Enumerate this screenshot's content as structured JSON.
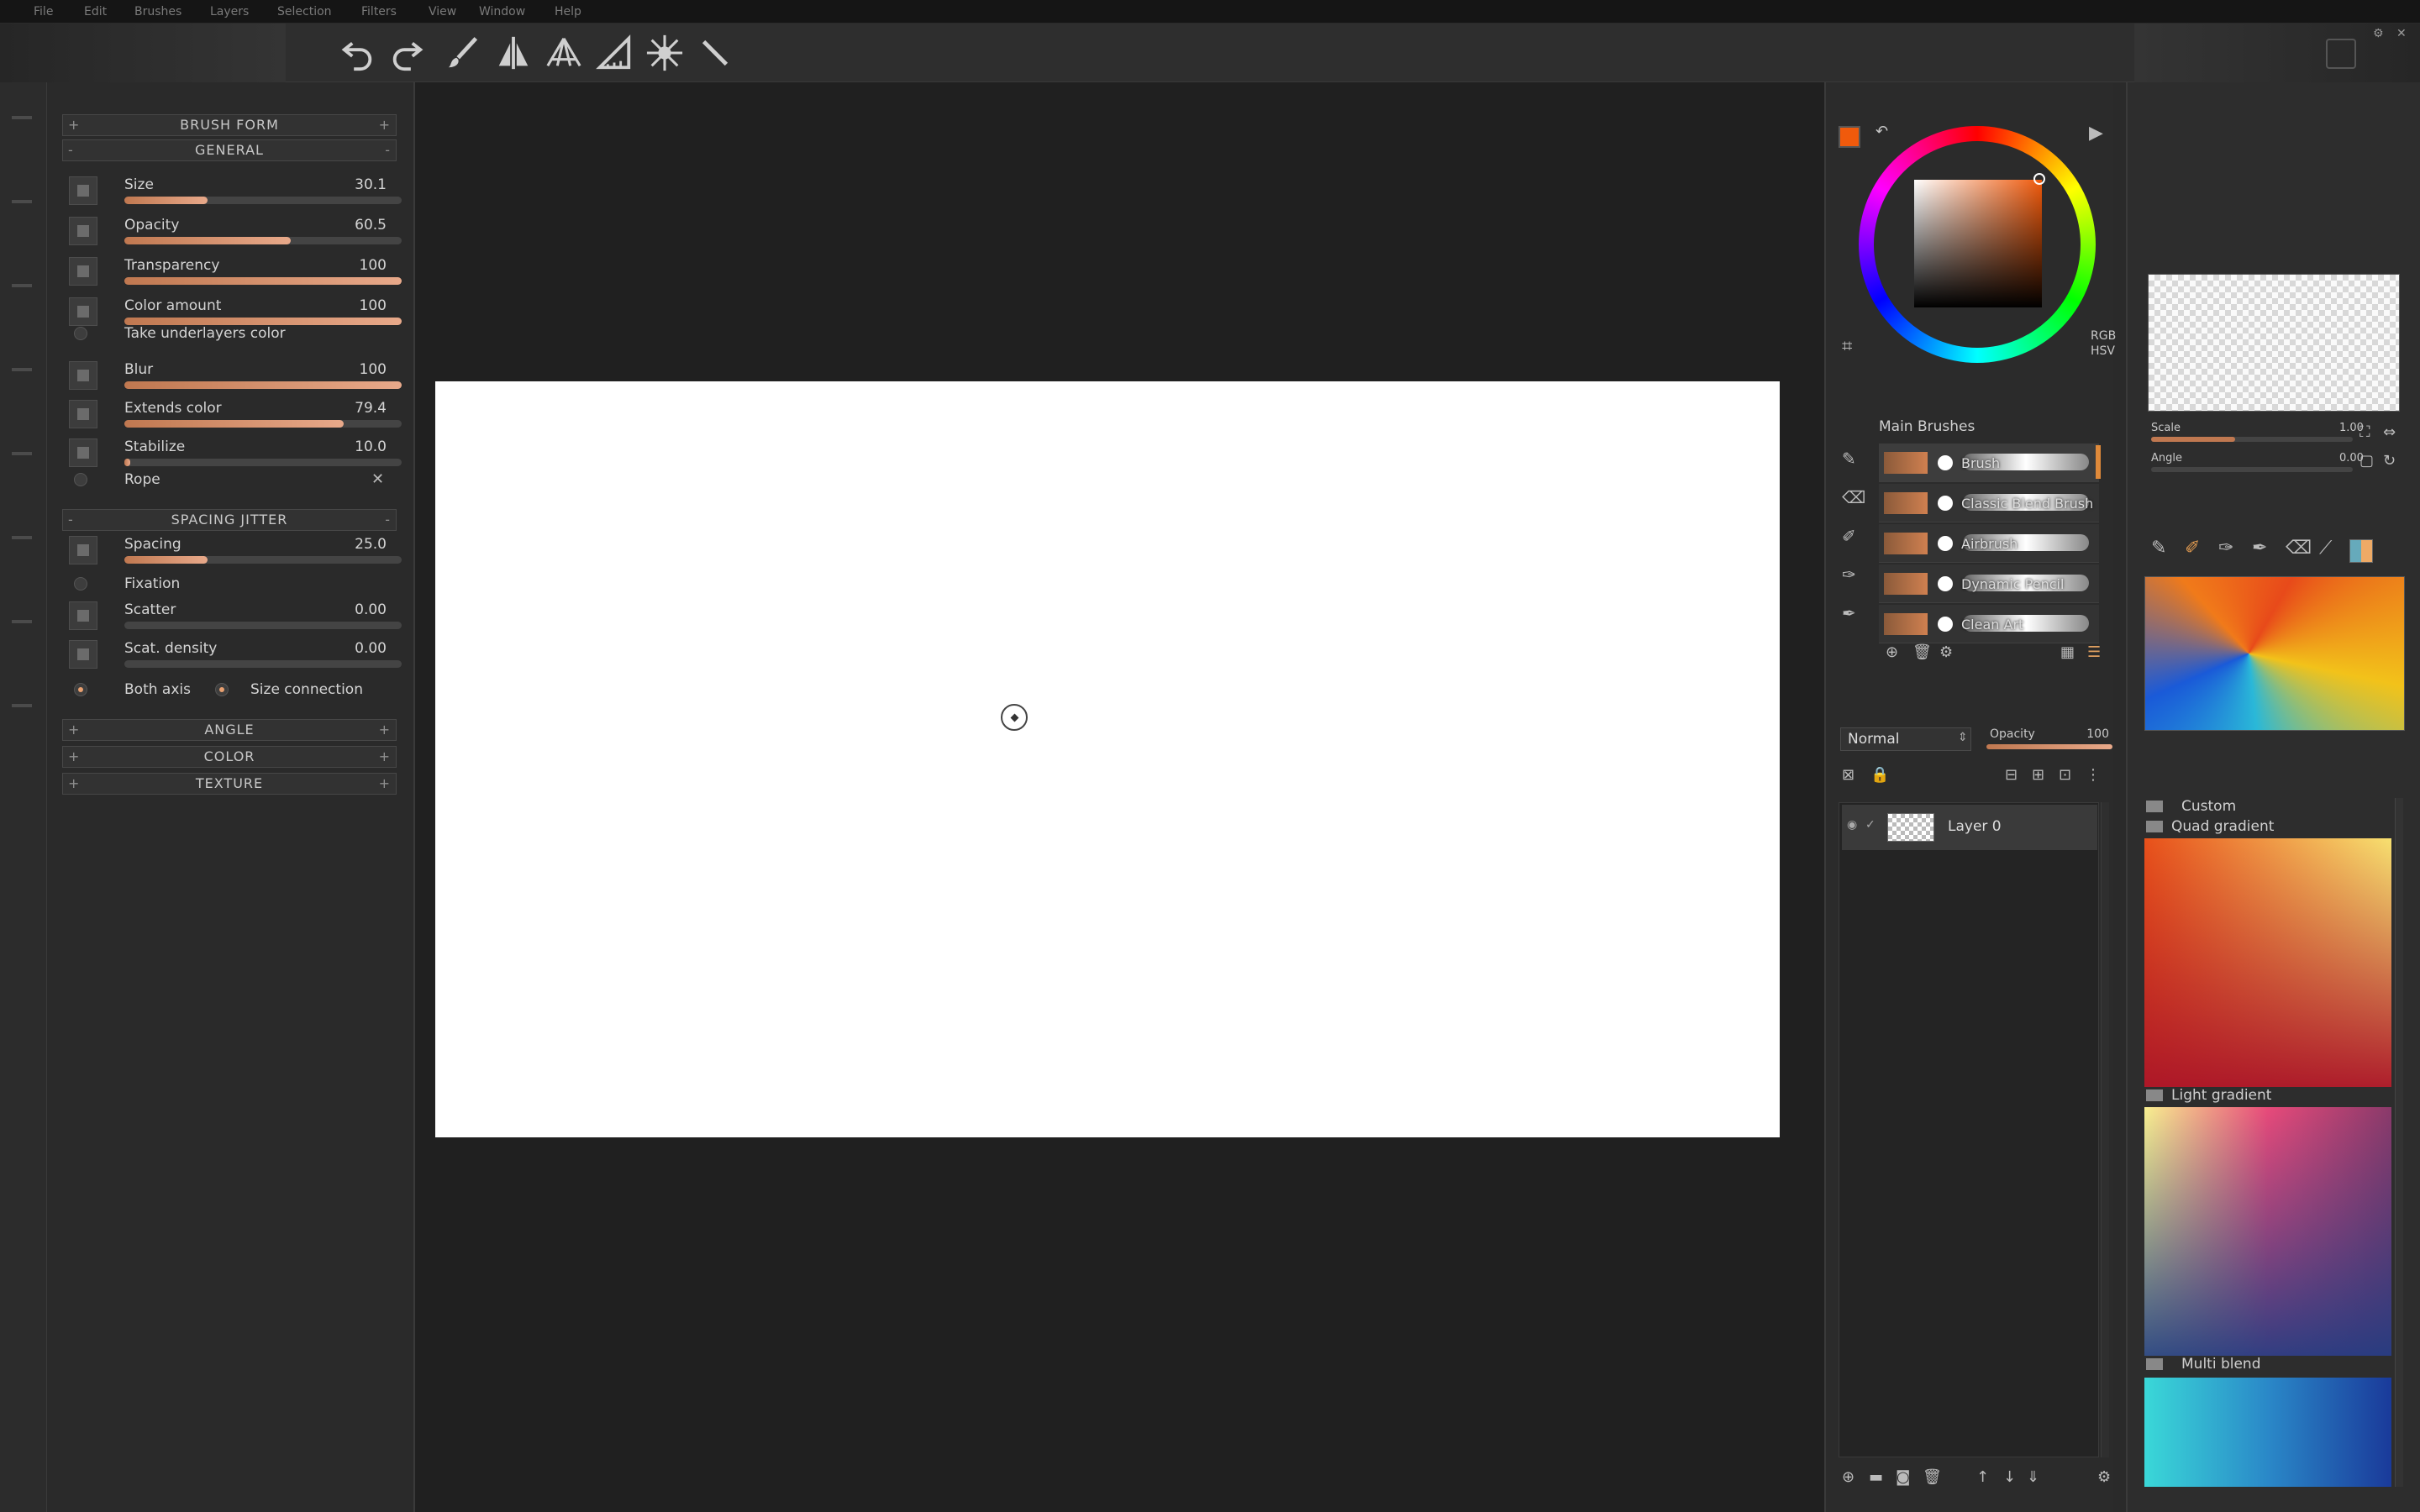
{
  "menubar": {
    "items": [
      "File",
      "Edit",
      "Brushes",
      "Layers",
      "Selection",
      "Filters",
      "View",
      "Window",
      "Help"
    ]
  },
  "toolbar": {
    "icons": [
      "undo-icon",
      "redo-icon",
      "brush-icon",
      "symmetry-icon",
      "perspective-icon",
      "ruler-triangle-icon",
      "mandala-icon",
      "straight-line-icon"
    ]
  },
  "brush_panel": {
    "sections": {
      "brush_form": "BRUSH FORM",
      "general": "GENERAL",
      "spacing_jitter": "SPACING JITTER",
      "angle": "ANGLE",
      "color": "COLOR",
      "texture": "TEXTURE"
    },
    "general_params": [
      {
        "label": "Size",
        "value": "30.1",
        "fill": 0.3
      },
      {
        "label": "Opacity",
        "value": "60.5",
        "fill": 0.6
      },
      {
        "label": "Transparency",
        "value": "100",
        "fill": 1.0
      },
      {
        "label": "Color amount",
        "value": "100",
        "fill": 1.0
      }
    ],
    "take_underlayers": "Take underlayers color",
    "general_params2": [
      {
        "label": "Blur",
        "value": "100",
        "fill": 1.0
      },
      {
        "label": "Extends color",
        "value": "79.4",
        "fill": 0.79
      },
      {
        "label": "Stabilize",
        "value": "10.0",
        "fill": 0.02
      }
    ],
    "rope": "Rope",
    "spacing_params": [
      {
        "label": "Spacing",
        "value": "25.0",
        "fill": 0.3
      }
    ],
    "fixation": "Fixation",
    "scatter_params": [
      {
        "label": "Scatter",
        "value": "0.00",
        "fill": 0.0
      },
      {
        "label": "Scat. density",
        "value": "0.00",
        "fill": 0.0
      }
    ],
    "both_axis": "Both axis",
    "size_connection": "Size connection"
  },
  "color_picker": {
    "fg_color": "#f05a0c",
    "rgb": "RGB",
    "hsv": "HSV"
  },
  "brushes": {
    "group": "Main Brushes",
    "items": [
      "Brush",
      "Classic Blend Brush",
      "Airbrush",
      "Dynamic Pencil",
      "Clean Art"
    ]
  },
  "layers": {
    "blend_mode": "Normal",
    "opacity_label": "Opacity",
    "opacity_value": "100",
    "items": [
      {
        "name": "Layer 0"
      }
    ]
  },
  "texture": {
    "scale_label": "Scale",
    "scale_value": "1.00",
    "angle_label": "Angle",
    "angle_value": "0.00"
  },
  "gradients": {
    "custom": "Custom",
    "quad": "Quad gradient",
    "light": "Light gradient",
    "multi": "Multi blend"
  }
}
